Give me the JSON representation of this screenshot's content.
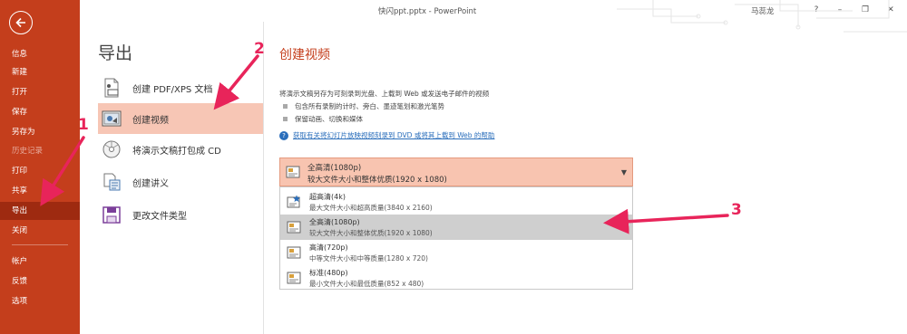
{
  "window": {
    "title": "快闪ppt.pptx - PowerPoint",
    "user": "马蕊龙",
    "help_label": "?",
    "minimize_label": "–",
    "restore_label": "❐",
    "close_label": "✕"
  },
  "sidebar": {
    "items": [
      {
        "label": "信息"
      },
      {
        "label": "新建"
      },
      {
        "label": "打开"
      },
      {
        "label": "保存"
      },
      {
        "label": "另存为"
      },
      {
        "label": "历史记录"
      },
      {
        "label": "打印"
      },
      {
        "label": "共享"
      },
      {
        "label": "导出"
      },
      {
        "label": "关闭"
      },
      {
        "label": "帐户"
      },
      {
        "label": "反馈"
      },
      {
        "label": "选项"
      }
    ]
  },
  "middle": {
    "heading": "导出",
    "items": [
      {
        "label": "创建 PDF/XPS 文档",
        "icon": "pdf-document-icon"
      },
      {
        "label": "创建视频",
        "icon": "video-icon"
      },
      {
        "label": "将演示文稿打包成 CD",
        "icon": "cd-icon"
      },
      {
        "label": "创建讲义",
        "icon": "handout-icon"
      },
      {
        "label": "更改文件类型",
        "icon": "file-type-icon"
      }
    ]
  },
  "right": {
    "title": "创建视频",
    "description": "将演示文稿另存为可刻录到光盘、上载到 Web 或发送电子邮件的视频",
    "bullets": [
      "包含所有录制的计时、旁白、墨迹笔划和激光笔势",
      "保留动画、切换和媒体"
    ],
    "help_link": "获取有关将幻灯片放映视频刻录到 DVD 或将其上载到 Web 的帮助",
    "dropdown": {
      "selected_title": "全高清(1080p)",
      "selected_sub": "较大文件大小和整体优质(1920 x 1080)",
      "options": [
        {
          "title": "超高清(4k)",
          "sub": "最大文件大小和超高质量(3840 x 2160)"
        },
        {
          "title": "全高清(1080p)",
          "sub": "较大文件大小和整体优质(1920 x 1080)"
        },
        {
          "title": "高清(720p)",
          "sub": "中等文件大小和中等质量(1280 x 720)"
        },
        {
          "title": "标准(480p)",
          "sub": "最小文件大小和最低质量(852 x 480)"
        }
      ]
    }
  },
  "annotations": [
    "1",
    "2",
    "3"
  ],
  "colors": {
    "accent": "#c43e1c",
    "selection": "#f7c6b5",
    "annotation": "#e8245a"
  }
}
